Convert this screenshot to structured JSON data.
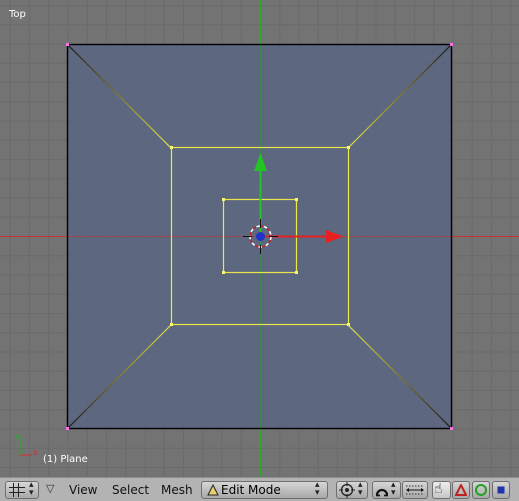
{
  "viewport": {
    "view_label": "Top",
    "object_label": "(1) Plane",
    "colors": {
      "background": "#737373",
      "grid": "#6b6b6b",
      "x_axis": "#c83232",
      "y_axis": "#2fa82f",
      "face": "#5b6680",
      "selected_edge": "#e8e84a",
      "vertex": "#ff6ef0",
      "widget_x": "#e52222",
      "widget_y": "#22c422",
      "widget_center": "#2233cc"
    }
  },
  "header": {
    "view_type_icon": "grid-icon",
    "menus": {
      "view": "View",
      "select": "Select",
      "mesh": "Mesh"
    },
    "mode_select": {
      "label": "Edit Mode",
      "icon": "triangle-icon"
    },
    "tool_icons": [
      "pivot-icon",
      "proportional-icon",
      "snap-icon",
      "hand-icon",
      "delta-icon",
      "circle-icon",
      "square-icon"
    ]
  }
}
